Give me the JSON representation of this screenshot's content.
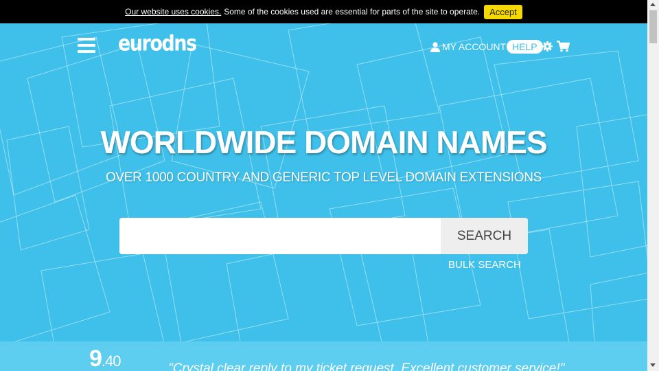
{
  "cookie_bar": {
    "link_text": "Our website uses cookies.",
    "message": "Some of the cookies used are essential for parts of the site to operate.",
    "accept_label": "Accept"
  },
  "header": {
    "logo": "eurodns",
    "account_label": "MY ACCOUNT",
    "help_label": "HELP",
    "icons": [
      "menu-icon",
      "user-icon",
      "gear-icon",
      "cart-icon"
    ]
  },
  "hero": {
    "title": "WORLDWIDE DOMAIN NAMES",
    "subtitle": "OVER 1000 COUNTRY AND GENERIC TOP LEVEL DOMAIN EXTENSIONS",
    "search": {
      "value": "",
      "placeholder": "",
      "button_label": "SEARCH"
    },
    "bulk_search_label": "BULK SEARCH"
  },
  "review": {
    "score_int": "9",
    "score_dec": ".40",
    "quote": "\"Crystal clear reply to my ticket request. Excellent customer service!\""
  },
  "colors": {
    "hero_bg": "#3ec0ea",
    "accept": "#f4d800",
    "cookie_bar": "#000000"
  }
}
